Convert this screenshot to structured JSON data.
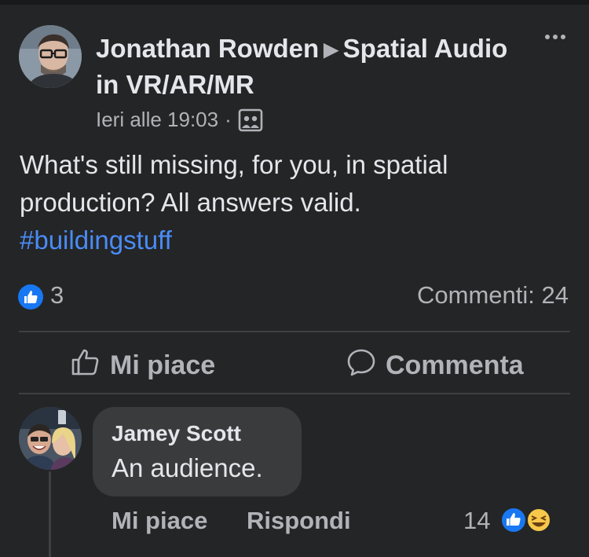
{
  "post": {
    "author": "Jonathan Rowden",
    "group": "Spatial Audio in VR/AR/MR",
    "timestamp": "Ieri alle 19:03",
    "separator": "·",
    "privacy_icon": "group-icon",
    "text": "What's still missing, for you, in spatial production? All answers valid.",
    "hashtag": "#buildingstuff",
    "reactions_count": "3",
    "comments_label": "Commenti: 24",
    "more_icon": "more-options-icon"
  },
  "actions": {
    "like_label": "Mi piace",
    "comment_label": "Commenta"
  },
  "comment": {
    "author": "Jamey Scott",
    "text": "An audience.",
    "like_label": "Mi piace",
    "reply_label": "Rispondi",
    "reactions_count": "14",
    "reaction_icons": [
      "like-icon",
      "haha-icon"
    ]
  },
  "colors": {
    "background": "#242526",
    "link": "#4a8cf7",
    "like_blue": "#1877f2",
    "bubble": "#3a3b3c"
  }
}
